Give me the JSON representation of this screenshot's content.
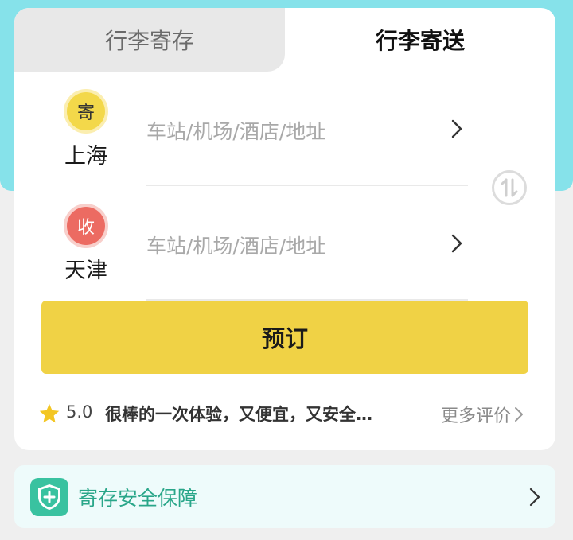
{
  "tabs": [
    {
      "label": "行李寄存",
      "active": false
    },
    {
      "label": "行李寄送",
      "active": true
    }
  ],
  "send": {
    "badge": "寄",
    "city": "上海",
    "address_placeholder": "车站/机场/酒店/地址"
  },
  "receive": {
    "badge": "收",
    "city": "天津",
    "address_placeholder": "车站/机场/酒店/地址"
  },
  "book_button": "预订",
  "review": {
    "rating": "5.0",
    "text": "很棒的一次体验，又便宜，又安全…",
    "more_label": "更多评价"
  },
  "safety": {
    "label": "寄存安全保障"
  },
  "colors": {
    "header_bg": "#86e2ea",
    "accent_yellow": "#f0d245",
    "send_badge": "#f3d84a",
    "receive_badge": "#ec6b62",
    "safety_green": "#39c2a0"
  },
  "icons": [
    "swap-icon",
    "chevron-right-icon",
    "star-icon",
    "shield-plus-icon"
  ]
}
